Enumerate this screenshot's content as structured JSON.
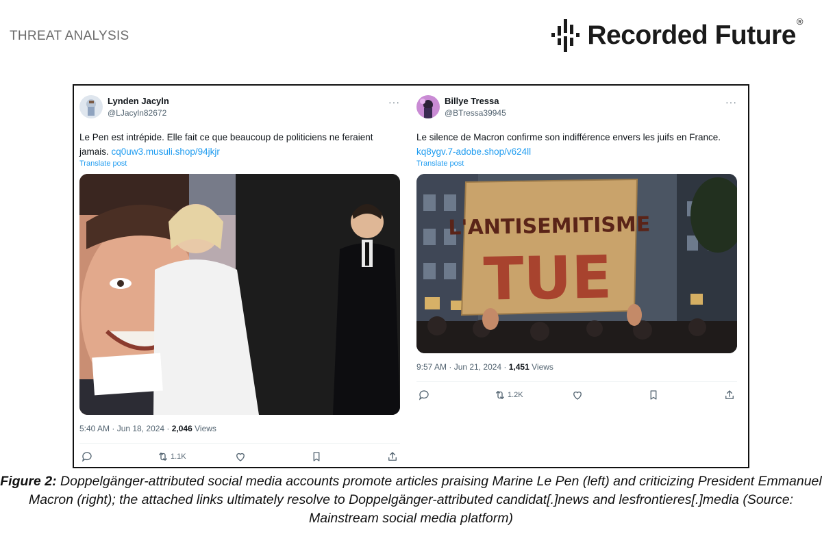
{
  "header": {
    "section_label": "THREAT ANALYSIS",
    "brand_name": "Recorded Future",
    "brand_reg": "®"
  },
  "tweets": [
    {
      "display_name": "Lynden Jacyln",
      "handle": "@LJacyln82672",
      "text": "Le Pen est intrépide. Elle fait ce que beaucoup de politiciens ne feraient jamais.",
      "link": "cq0uw3.musuli.shop/94jkjr",
      "translate_label": "Translate post",
      "timestamp": "5:40 AM · Jun 18, 2024 · ",
      "views_count": "2,046",
      "views_label": " Views",
      "retweets": "1.1K",
      "more_label": "···"
    },
    {
      "display_name": "Billye Tressa",
      "handle": "@BTressa39945",
      "text": "Le silence de Macron confirme son indifférence envers les juifs en France.",
      "link": "kq8ygv.7-adobe.shop/v624ll",
      "translate_label": "Translate post",
      "timestamp": "9:57 AM · Jun 21, 2024 · ",
      "views_count": "1,451",
      "views_label": " Views",
      "retweets": "1.2K",
      "more_label": "···",
      "sign_line1": "L'ANTISEMITISME",
      "sign_line2": "TUE"
    }
  ],
  "caption": {
    "label": "Figure 2:",
    "text": " Doppelgänger-attributed social media accounts promote articles praising Marine Le Pen (left) and criticizing President Emmanuel Macron (right); the attached links ultimately resolve to Doppelgänger-attributed candidat[.]news and lesfrontieres[.]media (Source: Mainstream social media platform)"
  },
  "colors": {
    "link": "#1d9bf0",
    "secondary_text": "#536471",
    "sign_cardboard": "#c9a36b",
    "sign_ink": "#a8432e"
  }
}
